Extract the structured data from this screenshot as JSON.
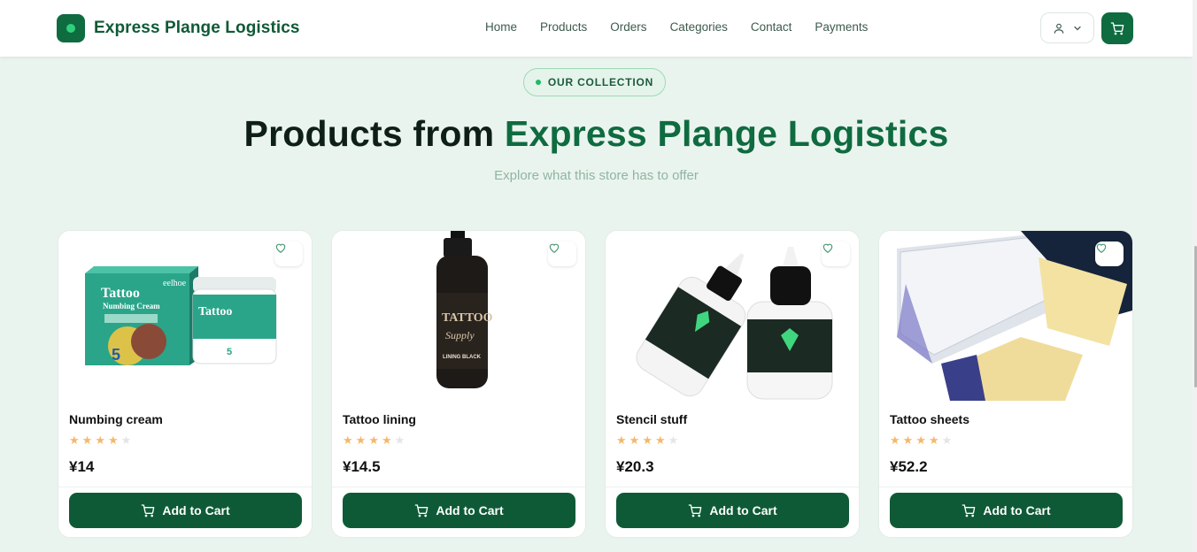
{
  "header": {
    "brand": "Express Plange Logistics",
    "nav": [
      "Home",
      "Products",
      "Orders",
      "Categories",
      "Contact",
      "Payments"
    ]
  },
  "hero": {
    "badge": "OUR COLLECTION",
    "title_prefix": "Products from ",
    "title_accent": "Express Plange Logistics",
    "subtitle": "Explore what this store has to offer"
  },
  "products": [
    {
      "name": "Numbing cream",
      "price": "¥14",
      "rating": 4,
      "button": "Add to Cart"
    },
    {
      "name": "Tattoo lining",
      "price": "¥14.5",
      "rating": 4,
      "button": "Add to Cart"
    },
    {
      "name": "Stencil stuff",
      "price": "¥20.3",
      "rating": 4,
      "button": "Add to Cart"
    },
    {
      "name": "Tattoo sheets",
      "price": "¥52.2",
      "rating": 4,
      "button": "Add to Cart"
    }
  ],
  "product_image_text": {
    "cream_brand": "eelhoe",
    "cream_title": "Tattoo",
    "cream_sub": "Numbing Cream",
    "cream_hours": "5",
    "bottle_brand": "TATTOO",
    "bottle_sub": "Supply",
    "bottle_label": "LINING BLACK"
  },
  "colors": {
    "primary": "#0f6b40",
    "button": "#0f5a36",
    "background": "#eaf4ee",
    "star": "#f5b86b"
  },
  "icons": [
    "user-icon",
    "chevron-down-icon",
    "cart-icon",
    "heart-icon"
  ]
}
